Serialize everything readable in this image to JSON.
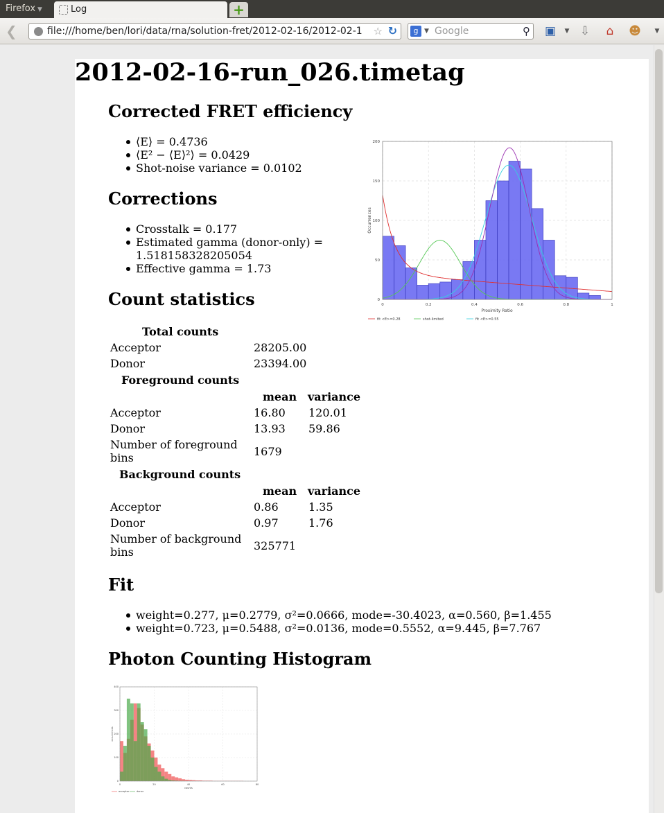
{
  "browser": {
    "app_menu": "Firefox",
    "tab_title": "Log",
    "url": "file:///home/ben/lori/data/rna/solution-fret/2012-02-16/2012-02-1",
    "search_placeholder": "Google",
    "search_engine_letter": "g"
  },
  "page": {
    "title": "2012-02-16-run_026.timetag",
    "fret_heading": "Corrected FRET efficiency",
    "fret_items": [
      "⟨E⟩ = 0.4736",
      "⟨E² − ⟨E⟩²⟩ = 0.0429",
      "Shot-noise variance = 0.0102"
    ],
    "corrections_heading": "Corrections",
    "corrections_items": [
      "Crosstalk = 0.177",
      "Estimated gamma (donor-only) =",
      "1.518158328205054",
      "Effective gamma = 1.73"
    ],
    "count_heading": "Count statistics",
    "total_caption": "Total counts",
    "total_rows": [
      {
        "label": "Acceptor",
        "value": "28205.00"
      },
      {
        "label": "Donor",
        "value": "23394.00"
      }
    ],
    "fg_caption": "Foreground counts",
    "col_mean": "mean",
    "col_variance": "variance",
    "fg_rows": [
      {
        "label": "Acceptor",
        "mean": "16.80",
        "variance": "120.01"
      },
      {
        "label": "Donor",
        "mean": "13.93",
        "variance": "59.86"
      }
    ],
    "fg_bins_label_1": "Number of foreground",
    "fg_bins_label_2": "bins",
    "fg_bins_value": "1679",
    "bg_caption": "Background counts",
    "bg_rows": [
      {
        "label": "Acceptor",
        "mean": "0.86",
        "variance": "1.35"
      },
      {
        "label": "Donor",
        "mean": "0.97",
        "variance": "1.76"
      }
    ],
    "bg_bins_label_1": "Number of background",
    "bg_bins_label_2": "bins",
    "bg_bins_value": "325771",
    "fit_heading": "Fit",
    "fit_items": [
      "weight=0.277, μ=0.2779, σ²=0.0666, mode=-30.4023, α=0.560, β=1.455",
      "weight=0.723, μ=0.5488, σ²=0.0136, mode=0.5552, α=9.445, β=7.767"
    ],
    "pch_heading": "Photon Counting Histogram"
  },
  "chart_data": [
    {
      "type": "bar",
      "xlabel": "Proximity Ratio",
      "ylabel": "Occurrences",
      "xlim": [
        0,
        1
      ],
      "ylim": [
        0,
        200
      ],
      "xticks": [
        "0",
        "0.2",
        "0.4",
        "0.6",
        "0.8",
        "1"
      ],
      "yticks": [
        "0",
        "50",
        "100",
        "150",
        "200"
      ],
      "bin_edges": [
        0,
        0.05,
        0.1,
        0.15,
        0.2,
        0.25,
        0.3,
        0.35,
        0.4,
        0.45,
        0.5,
        0.55,
        0.6,
        0.65,
        0.7,
        0.75,
        0.8,
        0.85,
        0.9,
        0.95
      ],
      "values": [
        80,
        68,
        40,
        18,
        20,
        22,
        25,
        48,
        75,
        125,
        150,
        175,
        165,
        115,
        75,
        30,
        28,
        8,
        5
      ],
      "bar_color": "#6a6af2",
      "grid": true,
      "legend_placement": "bottom",
      "series": [
        {
          "name": "fit <E>=0.28",
          "color": "#e03030"
        },
        {
          "name": "shot-limited",
          "color": "#55c855"
        },
        {
          "name": "fit <E>=0.55",
          "color": "#35d0e0"
        }
      ]
    },
    {
      "type": "bar",
      "xlabel": "counts",
      "ylabel": "occurrences",
      "xlim": [
        0,
        80
      ],
      "ylim": [
        0,
        400
      ],
      "xticks": [
        "0",
        "20",
        "40",
        "60",
        "80"
      ],
      "yticks": [
        "0",
        "100",
        "200",
        "300",
        "400"
      ],
      "bin_width": 2,
      "grid": true,
      "legend_placement": "bottom",
      "series": [
        {
          "name": "acceptor",
          "color": "#f05050",
          "values": [
            170,
            120,
            180,
            260,
            330,
            310,
            240,
            190,
            160,
            130,
            100,
            70,
            55,
            40,
            30,
            20,
            16,
            12,
            8,
            6,
            5,
            4,
            3,
            3,
            2,
            2,
            2,
            1,
            1,
            1,
            1,
            1,
            1,
            1,
            1,
            1
          ]
        },
        {
          "name": "donor",
          "color": "#4aaa4a",
          "values": [
            40,
            150,
            350,
            330,
            170,
            330,
            250,
            220,
            150,
            100,
            60,
            40,
            20,
            10,
            5,
            3,
            2,
            1,
            1,
            0,
            0,
            0,
            0,
            0,
            0,
            0,
            0,
            0,
            0,
            0,
            0,
            0,
            0,
            0,
            0,
            0
          ]
        }
      ]
    }
  ]
}
